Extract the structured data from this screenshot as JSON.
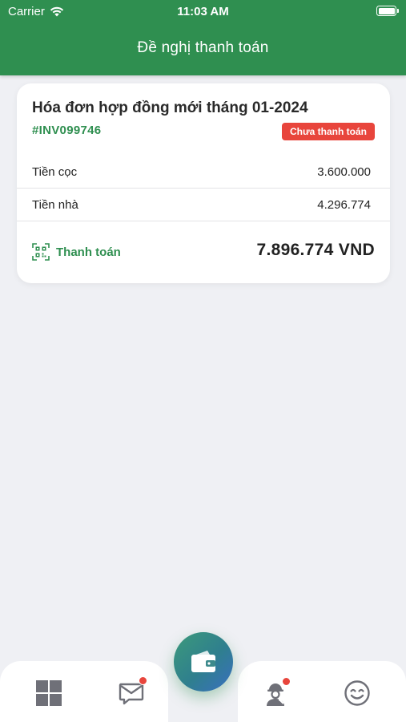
{
  "status_bar": {
    "carrier": "Carrier",
    "time": "11:03 AM"
  },
  "header": {
    "title": "Đề nghị thanh toán",
    "color": "#2f8f50"
  },
  "invoice": {
    "title": "Hóa đơn hợp đồng mới tháng 01-2024",
    "code": "#INV099746",
    "status": "Chưa thanh toán",
    "status_color": "#e8453c",
    "items": [
      {
        "label": "Tiền cọc",
        "amount": "3.600.000"
      },
      {
        "label": "Tiền nhà",
        "amount": "4.296.774"
      }
    ],
    "pay_label": "Thanh toán",
    "pay_icon": "qr-code-icon",
    "total": "7.896.774 VND"
  },
  "tabbar": {
    "tabs": [
      {
        "icon": "grid-icon",
        "badge": false
      },
      {
        "icon": "message-icon",
        "badge": true
      },
      {
        "icon": "wallet-icon",
        "center": true
      },
      {
        "icon": "worker-icon",
        "badge": true
      },
      {
        "icon": "smiley-icon",
        "badge": false
      }
    ]
  }
}
